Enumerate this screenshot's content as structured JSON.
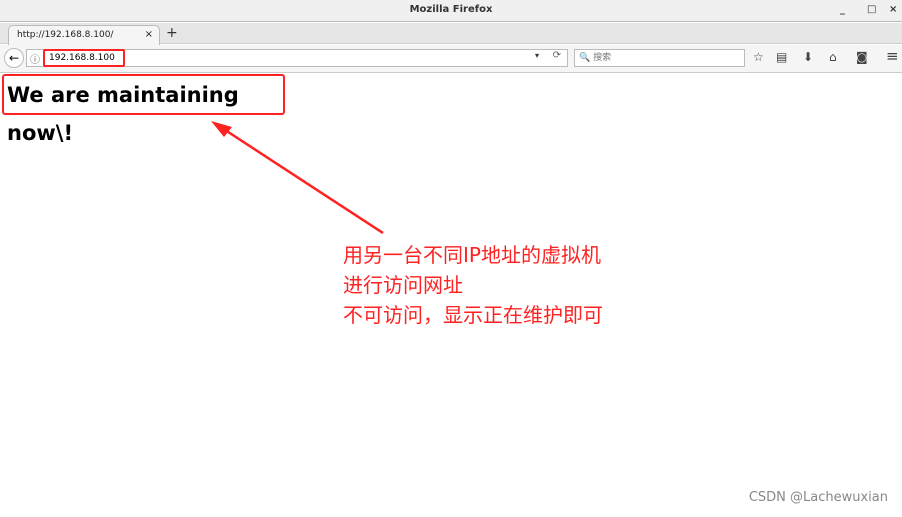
{
  "window": {
    "title": "Mozilla Firefox",
    "minimize": "_",
    "maximize": "□",
    "close": "×"
  },
  "tab": {
    "title": "http://192.168.8.100/",
    "close": "×",
    "new_tab": "+"
  },
  "nav": {
    "back": "←",
    "info": "ⓘ",
    "url": "192.168.8.100",
    "dropdown": "▾",
    "reload": "⟳",
    "search_placeholder": "🔍 搜索"
  },
  "toolbar": {
    "bookmark": "☆",
    "library": "▤",
    "downloads": "⬇",
    "home": "⌂",
    "pocket": "◙",
    "menu": "≡"
  },
  "page": {
    "heading": "We are maintaining now\\!"
  },
  "annotation": {
    "lines": [
      "用另一台不同IP地址的虚拟机",
      "进行访问网址",
      "不可访问，显示正在维护即可"
    ],
    "color": "#ff2020"
  },
  "watermark": "CSDN @Lachewuxian"
}
